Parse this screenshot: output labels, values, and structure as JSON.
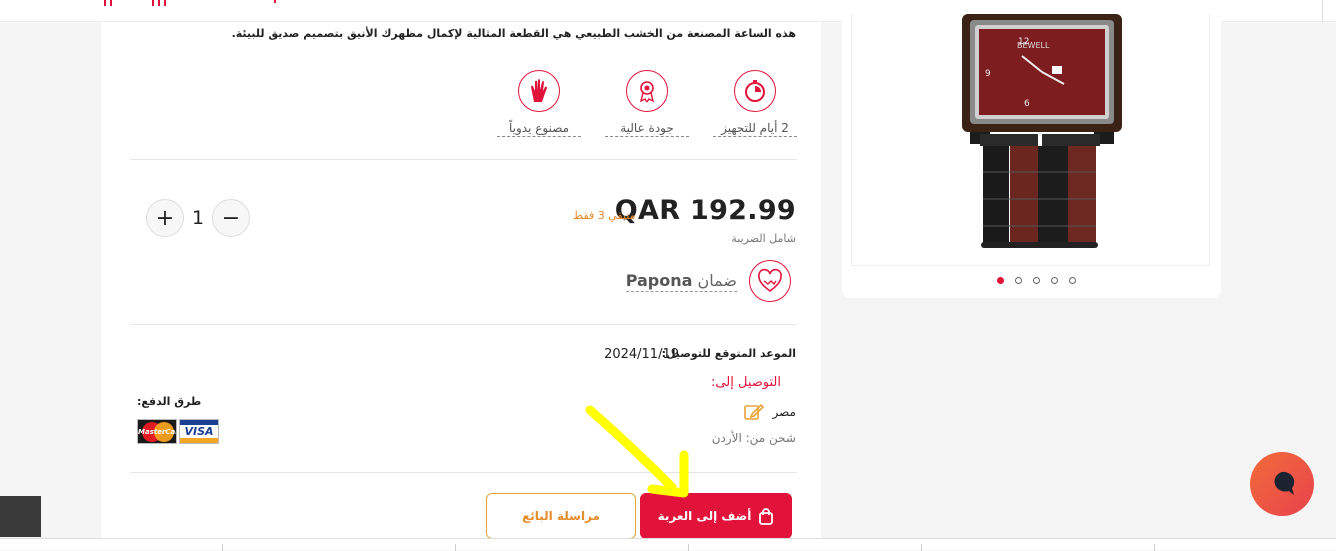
{
  "product": {
    "description": "هذه الساعة المصنعة من الخشب الطبيعي هي القطعة المثالية لإكمال مظهرك الأنيق بتصميم صديق للبيئة.",
    "features": [
      {
        "icon": "stopwatch-icon",
        "label": "2 أيام للتجهيز"
      },
      {
        "icon": "award-ribbon-icon",
        "label": "جودة عالية"
      },
      {
        "icon": "hand-icon",
        "label": "مصنوع يدوياً"
      }
    ],
    "price": "QAR 192.99",
    "stock_note": "متبقي 3 فقط",
    "tax_note": "شامل الضريبة",
    "warranty_prefix": "ضمان",
    "warranty_brand": "Papona",
    "quantity": "1",
    "quantity_plus": "+",
    "quantity_minus": "−"
  },
  "delivery": {
    "eta_label": "الموعد المتوقع للتوصيل:",
    "eta_date": "2024/11/19",
    "ship_to_label": "التوصيل إلى:",
    "country": "مصر",
    "ship_from": "شحن من: الأردن"
  },
  "payment": {
    "label": "طرق الدفع:",
    "cards": [
      "MasterCard",
      "VISA"
    ]
  },
  "actions": {
    "add_to_cart": "أضف إلى العربة",
    "message_seller": "مراسلة البائع"
  },
  "gallery": {
    "slide_count": 5,
    "active_index": 0,
    "watch_brand": "BEWELL"
  },
  "colors": {
    "accent": "#e2133b",
    "warning": "#e58b28",
    "highlight_arrow": "#ffff00",
    "chat_bubble": "#f26b3a"
  }
}
